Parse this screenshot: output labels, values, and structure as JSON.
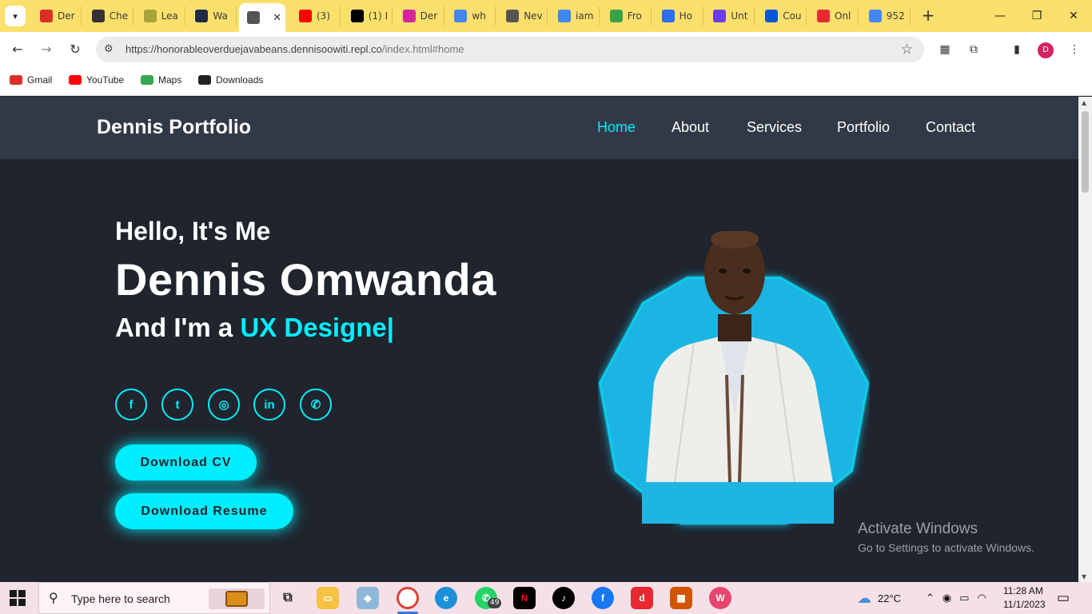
{
  "browser": {
    "tabs": [
      {
        "label": "Der",
        "icon": "gmail-icon",
        "color": "#d93025"
      },
      {
        "label": "Che",
        "icon": "location-icon",
        "color": "#333333"
      },
      {
        "label": "Lea",
        "icon": "learn-icon",
        "color": "#a8a23a"
      },
      {
        "label": "Wa",
        "icon": "wordpress-icon",
        "color": "#1f2a44"
      },
      {
        "label": "",
        "icon": "globe-icon",
        "color": "#555555",
        "active": true
      },
      {
        "label": "(3)",
        "icon": "youtube-icon",
        "color": "#ff0000"
      },
      {
        "label": "(1) I",
        "icon": "x-icon",
        "color": "#000000"
      },
      {
        "label": "Der",
        "icon": "instagram-icon",
        "color": "#d6249f"
      },
      {
        "label": "wh",
        "icon": "google-icon",
        "color": "#4285f4"
      },
      {
        "label": "Nev",
        "icon": "chrome-icon",
        "color": "#555555"
      },
      {
        "label": "iam",
        "icon": "google-icon",
        "color": "#4285f4"
      },
      {
        "label": "Fro",
        "icon": "infinity-icon",
        "color": "#3aa34a"
      },
      {
        "label": "Ho",
        "icon": "canva-icon",
        "color": "#2d6ef2"
      },
      {
        "label": "Unt",
        "icon": "canva-icon",
        "color": "#6a3df2"
      },
      {
        "label": "Cou",
        "icon": "coursera-icon",
        "color": "#0056d2"
      },
      {
        "label": "Onl",
        "icon": "draw-icon",
        "color": "#e82830"
      },
      {
        "label": "952",
        "icon": "google-icon",
        "color": "#4285f4"
      }
    ],
    "url_host": "https://honorableoverduejavabeans.dennisoowiti.repl.co",
    "url_path": "/index.html#home",
    "profile_initial": "D",
    "bookmarks": [
      {
        "label": "Gmail",
        "icon": "gmail-icon",
        "color": "#d93025"
      },
      {
        "label": "YouTube",
        "icon": "youtube-icon",
        "color": "#ff0000"
      },
      {
        "label": "Maps",
        "icon": "maps-icon",
        "color": "#34a853"
      },
      {
        "label": "Downloads",
        "icon": "download-icon",
        "color": "#222222"
      }
    ]
  },
  "site": {
    "logo": "Dennis Portfolio",
    "nav": [
      {
        "label": "Home",
        "active": true
      },
      {
        "label": "About"
      },
      {
        "label": "Services"
      },
      {
        "label": "Portfolio"
      },
      {
        "label": "Contact"
      }
    ],
    "greeting": "Hello, It's Me",
    "name": "Dennis Omwanda",
    "role_prefix": "And I'm a ",
    "role_highlight": "UX Designe",
    "role_cursor": "|",
    "social": [
      {
        "icon": "facebook-icon",
        "glyph": "f"
      },
      {
        "icon": "twitter-icon",
        "glyph": "t"
      },
      {
        "icon": "instagram-icon",
        "glyph": "◎"
      },
      {
        "icon": "linkedin-icon",
        "glyph": "in"
      },
      {
        "icon": "whatsapp-icon",
        "glyph": "✆"
      }
    ],
    "buttons": {
      "cv": "Download CV",
      "resume": "Download Resume"
    },
    "accent_color": "#00eeff",
    "bg_color": "#1f242d",
    "header_color": "#323946"
  },
  "watermark": {
    "line1": "Activate Windows",
    "line2": "Go to Settings to activate Windows."
  },
  "taskbar": {
    "search_placeholder": "Type here to search",
    "whatsapp_badge": "49",
    "weather": "22°C",
    "time": "11:28 AM",
    "date": "11/1/2023"
  }
}
